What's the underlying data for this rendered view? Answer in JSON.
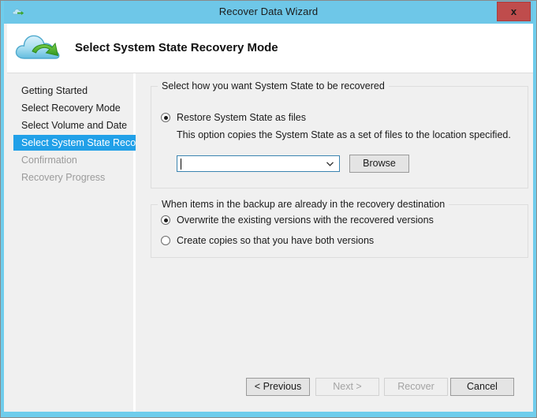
{
  "window": {
    "title": "Recover Data Wizard",
    "titlebar_icon": "cloud-arrow-icon",
    "close_label": "x",
    "accent_color": "#6ec7e8",
    "close_color": "#bf4c4c"
  },
  "header": {
    "logo_icon": "cloud-recovery-logo",
    "title": "Select System State Recovery Mode"
  },
  "sidebar": {
    "items": [
      {
        "label": "Getting Started",
        "state": "normal"
      },
      {
        "label": "Select Recovery Mode",
        "state": "normal"
      },
      {
        "label": "Select Volume and Date",
        "state": "normal"
      },
      {
        "label": "Select System State Reco...",
        "state": "selected"
      },
      {
        "label": "Confirmation",
        "state": "disabled"
      },
      {
        "label": "Recovery Progress",
        "state": "disabled"
      }
    ],
    "selected_color": "#21a0e8"
  },
  "main": {
    "group1": {
      "legend": "Select how you want System State to be recovered",
      "radio": {
        "label": "Restore System State as files",
        "checked": true
      },
      "hint": "This option copies the System State as a set of files to the location specified.",
      "combo": {
        "value": "",
        "placeholder": "",
        "arrow_icon": "chevron-down-icon",
        "focused": true
      },
      "browse_label": "Browse"
    },
    "group2": {
      "legend": "When items in the backup are already in the recovery destination",
      "options": [
        {
          "label": "Overwrite the existing versions with the recovered versions",
          "checked": true
        },
        {
          "label": "Create copies so that you have both versions",
          "checked": false
        }
      ]
    }
  },
  "footer": {
    "buttons": [
      {
        "label": "< Previous",
        "enabled": true
      },
      {
        "label": "Next >",
        "enabled": false
      },
      {
        "label": "Recover",
        "enabled": false
      },
      {
        "label": "Cancel",
        "enabled": true
      }
    ]
  }
}
